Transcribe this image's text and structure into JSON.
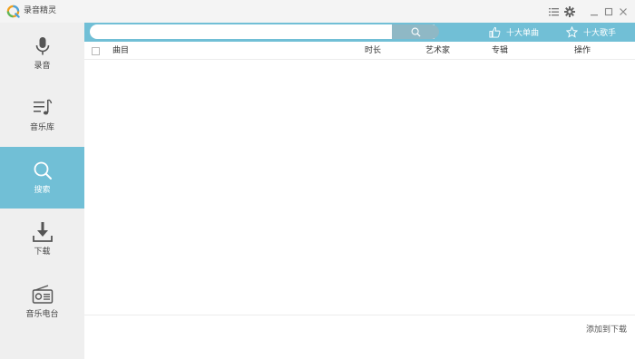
{
  "app": {
    "title": "录音精灵"
  },
  "colors": {
    "accent": "#71bfd6",
    "sidebar_bg": "#efefef",
    "titlebar_bg": "#f4f4f4"
  },
  "titlebar": {
    "icons": [
      "list-icon",
      "gear-icon",
      "minimize-icon",
      "maximize-icon",
      "close-icon"
    ]
  },
  "sidebar": {
    "items": [
      {
        "label": "录音",
        "icon": "microphone-icon",
        "active": false
      },
      {
        "label": "音乐库",
        "icon": "music-library-icon",
        "active": false
      },
      {
        "label": "搜索",
        "icon": "search-icon",
        "active": true
      },
      {
        "label": "下载",
        "icon": "download-icon",
        "active": false
      },
      {
        "label": "音乐电台",
        "icon": "radio-icon",
        "active": false
      }
    ]
  },
  "search": {
    "value": "",
    "placeholder": ""
  },
  "toplinks": {
    "top_songs": "十大单曲",
    "top_singers": "十大歌手"
  },
  "table": {
    "columns": {
      "song": "曲目",
      "duration": "时长",
      "artist": "艺术家",
      "album": "专辑",
      "actions": "操作"
    },
    "rows": []
  },
  "footer": {
    "add_to_download": "添加到下载"
  }
}
